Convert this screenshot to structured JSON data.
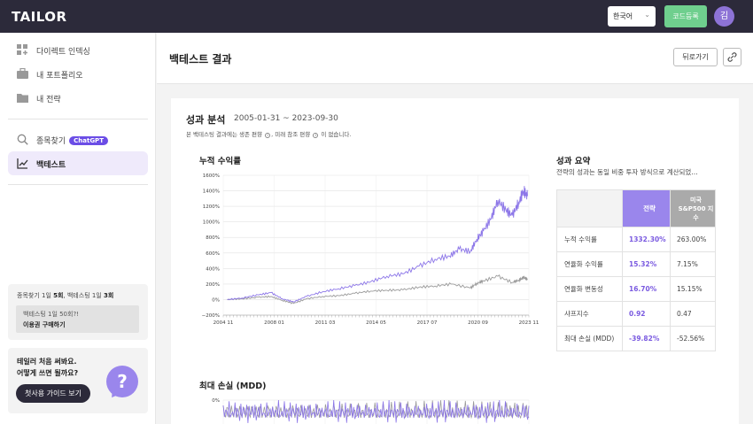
{
  "app": {
    "logo": "TAILOR"
  },
  "topbar": {
    "language": "한국어",
    "code_button": "코드등록",
    "avatar": "김"
  },
  "sidebar": {
    "items": [
      {
        "label": "다이렉트 인덱싱",
        "icon": "grid-plus-icon"
      },
      {
        "label": "내 포트폴리오",
        "icon": "briefcase-icon"
      },
      {
        "label": "내 전략",
        "icon": "folder-icon"
      },
      {
        "label": "종목찾기",
        "icon": "search-icon",
        "badge": "ChatGPT"
      },
      {
        "label": "백테스트",
        "icon": "chart-icon",
        "active": true
      }
    ],
    "usage": {
      "prefix": "종목찾기 1일 ",
      "search_count": "5회",
      "middle": ", 백테스팅 1일 ",
      "backtest_count": "3회",
      "upgrade_note": "백테스팅 1일 50회?!",
      "upgrade_link": "이용권 구매하기"
    },
    "guide": {
      "line1": "테일러 처음 써봐요.",
      "line2": "어떻게 쓰면 될까요?",
      "button": "첫사용 가이드 보기",
      "bubble": "?"
    }
  },
  "header": {
    "title": "백테스트 결과",
    "back_button": "뒤로가기"
  },
  "analysis": {
    "title": "성과 분석",
    "range": "2005-01-31 ~ 2023-09-30",
    "note_a": "본 백테스팅 결과에는 생존 편향",
    "note_b": ", 미래 참조 편향",
    "note_c": "이 없습니다.",
    "cumulative_title": "누적 수익률",
    "mdd_title": "최대 손실 (MDD)"
  },
  "summary": {
    "title": "성과 요약",
    "subtitle": "전략의 성과는 동일 비중 투자 방식으로 계산되었…",
    "col_strategy": "전략",
    "col_benchmark": [
      "미국",
      "S&P500 지",
      "수"
    ],
    "rows": [
      {
        "label": "누적 수익률",
        "strategy": "1332.30%",
        "benchmark": "263.00%"
      },
      {
        "label": "연율화 수익률",
        "strategy": "15.32%",
        "benchmark": "7.15%"
      },
      {
        "label": "연율화 변동성",
        "strategy": "16.70%",
        "benchmark": "15.15%"
      },
      {
        "label": "샤프지수",
        "strategy": "0.92",
        "benchmark": "0.47"
      },
      {
        "label": "최대 손실 (MDD)",
        "strategy": "-39.82%",
        "benchmark": "-52.56%"
      }
    ]
  },
  "chart_data": [
    {
      "type": "line",
      "title": "누적 수익률",
      "xlabel": "",
      "ylabel": "",
      "x_tick_labels": [
        "2004 11",
        "2008 01",
        "2011 03",
        "2014 05",
        "2017 07",
        "2020 09",
        "2023 11"
      ],
      "y_tick_labels": [
        "1600%",
        "1400%",
        "1200%",
        "1000%",
        "800%",
        "600%",
        "400%",
        "200%",
        "0%",
        "−200%"
      ],
      "ylim": [
        -200,
        1600
      ],
      "grid": true,
      "colors": {
        "strategy": "#8c76e8",
        "benchmark": "#9a9a9a"
      },
      "series": [
        {
          "x": [
            2005.08,
            2006.0,
            2007.0,
            2007.8,
            2008.5,
            2009.2,
            2010.0,
            2011.0,
            2012.0,
            2013.0,
            2014.0,
            2015.0,
            2016.0,
            2017.0,
            2018.0,
            2018.9,
            2019.5,
            2020.2,
            2020.6,
            2021.0,
            2021.5,
            2021.9,
            2022.4,
            2022.8,
            2023.2,
            2023.5,
            2023.75
          ],
          "values": [
            0,
            20,
            60,
            90,
            10,
            -30,
            40,
            100,
            140,
            180,
            230,
            300,
            330,
            430,
            520,
            560,
            650,
            620,
            780,
            880,
            1050,
            1280,
            1150,
            1080,
            1250,
            1400,
            1332
          ]
        },
        {
          "x": [
            2005.08,
            2006.0,
            2007.0,
            2007.8,
            2008.5,
            2009.2,
            2010.0,
            2011.0,
            2012.0,
            2013.0,
            2014.0,
            2015.0,
            2016.0,
            2017.0,
            2018.0,
            2019.0,
            2020.2,
            2020.6,
            2021.0,
            2021.9,
            2022.8,
            2023.2,
            2023.5,
            2023.75
          ],
          "values": [
            0,
            10,
            30,
            40,
            -10,
            -50,
            10,
            40,
            50,
            80,
            110,
            120,
            125,
            160,
            175,
            200,
            150,
            210,
            240,
            300,
            220,
            250,
            280,
            263
          ]
        }
      ]
    },
    {
      "type": "line",
      "title": "최대 손실 (MDD)",
      "xlabel": "",
      "ylabel": "",
      "y_tick_labels": [
        "0%"
      ],
      "grid": true,
      "colors": {
        "strategy": "#8c76e8",
        "benchmark": "#9a9a9a"
      }
    }
  ]
}
